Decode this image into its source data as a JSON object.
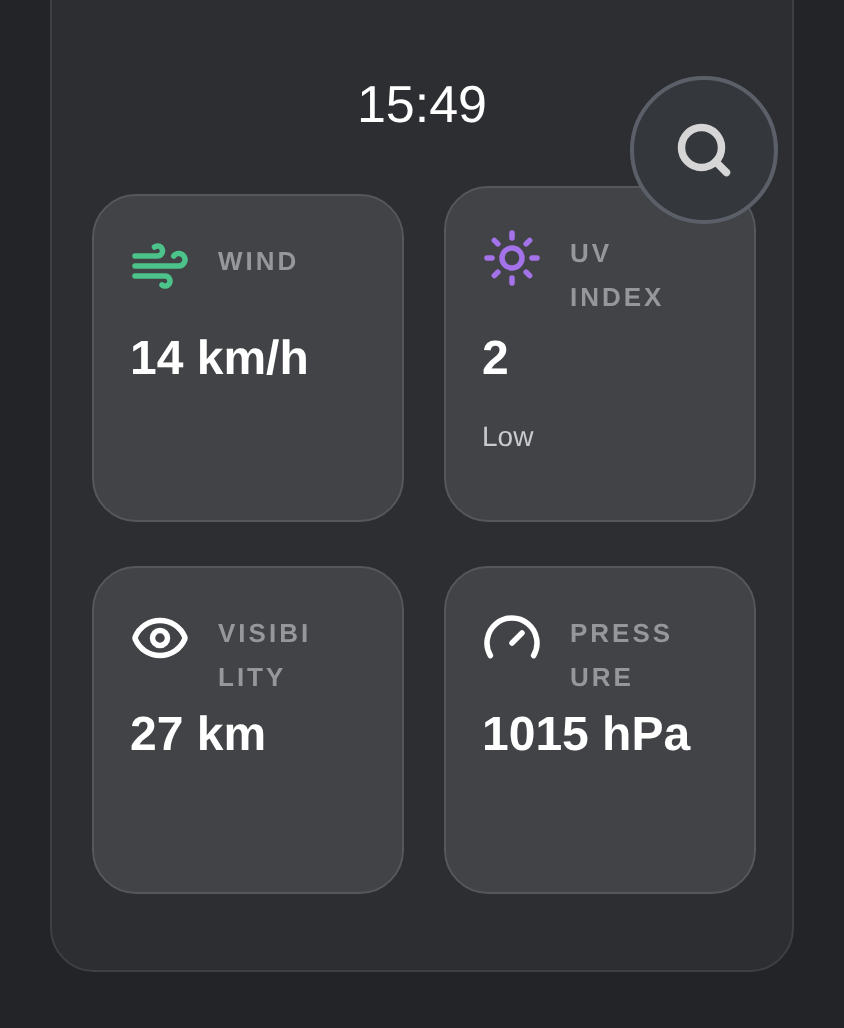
{
  "time": "15:49",
  "cards": [
    {
      "kind": "wind",
      "label": "WIND",
      "value": "14 km/h"
    },
    {
      "kind": "uv",
      "label": "UV INDEX",
      "value": "2",
      "note": "Low"
    },
    {
      "kind": "visibility",
      "label": "VISIBILITY",
      "value": "27 km"
    },
    {
      "kind": "pressure",
      "label": "PRESSURE",
      "value": "1015 hPa"
    }
  ]
}
